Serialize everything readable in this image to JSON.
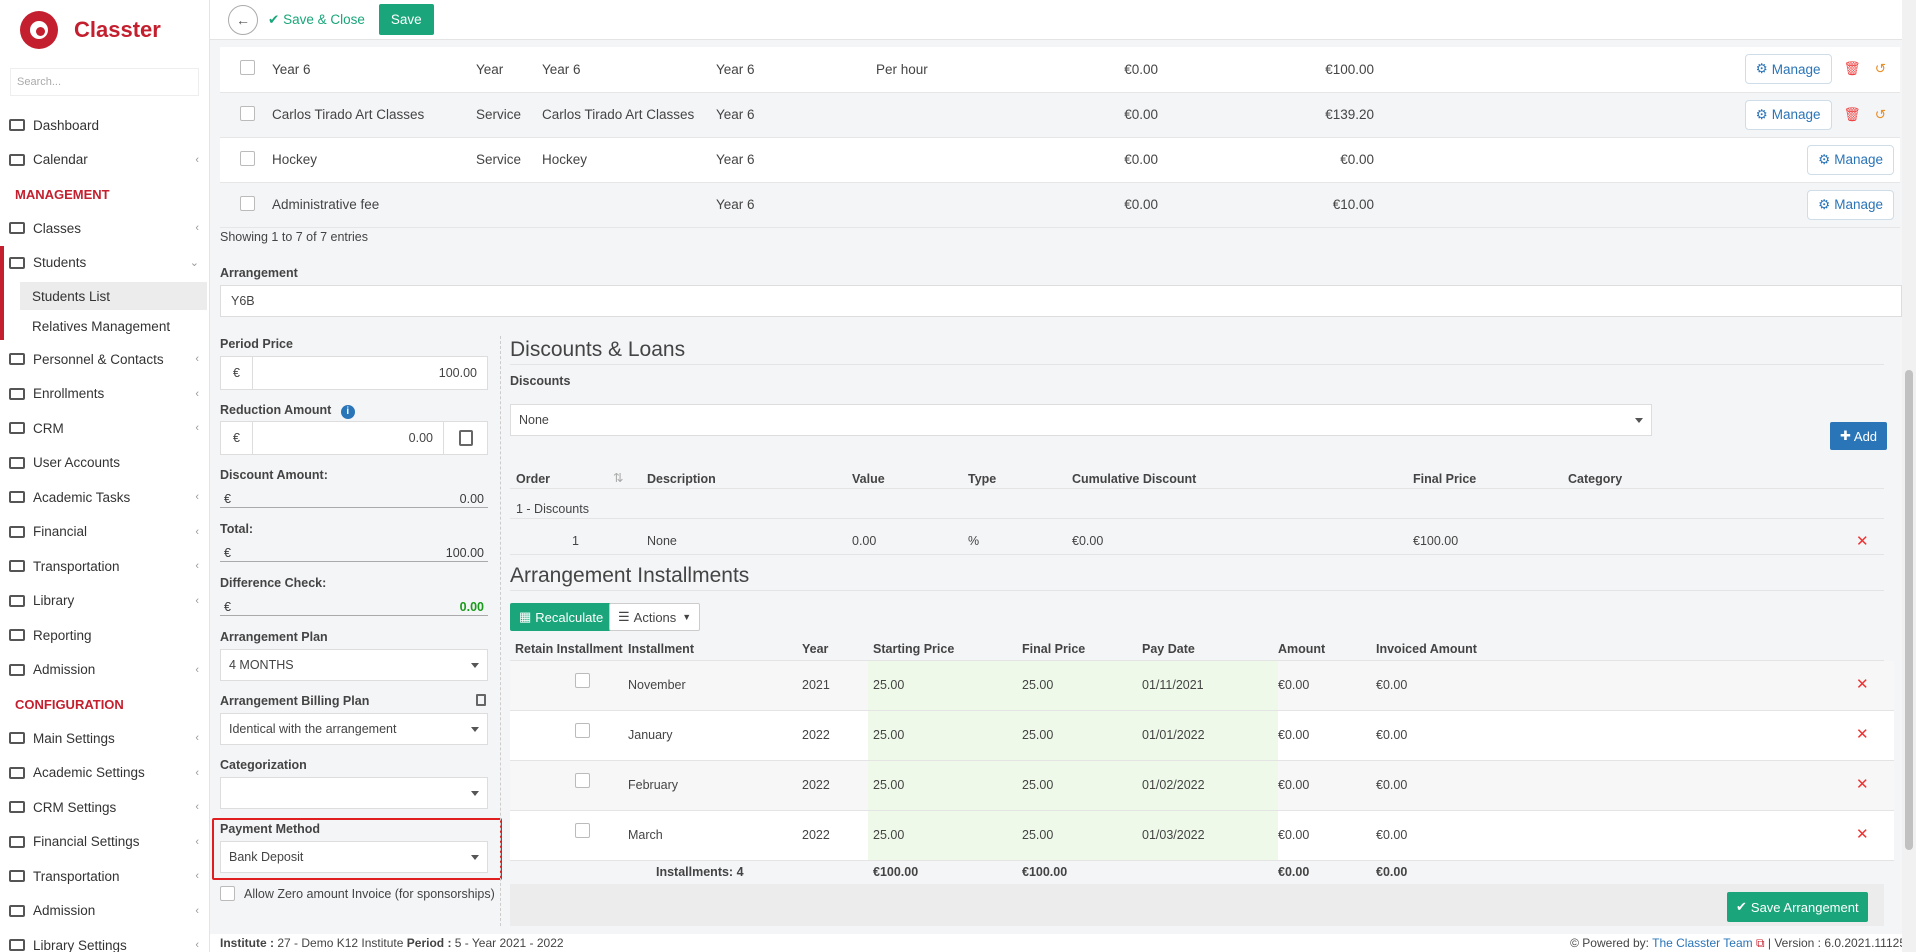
{
  "brand": {
    "name": "Classter"
  },
  "sidebar": {
    "search_placeholder": "Search...",
    "items_top": [
      {
        "label": "Dashboard",
        "chev": false
      },
      {
        "label": "Calendar",
        "chev": true
      }
    ],
    "management_header": "MANAGEMENT",
    "items_mgmt_a": [
      {
        "label": "Classes",
        "chev": true
      }
    ],
    "students": {
      "label": "Students",
      "subs": [
        "Students List",
        "Relatives Management"
      ]
    },
    "items_mgmt_b": [
      {
        "label": "Personnel & Contacts",
        "chev": true
      },
      {
        "label": "Enrollments",
        "chev": true
      },
      {
        "label": "CRM",
        "chev": true
      },
      {
        "label": "User Accounts",
        "chev": false
      },
      {
        "label": "Academic Tasks",
        "chev": true
      },
      {
        "label": "Financial",
        "chev": true
      },
      {
        "label": "Transportation",
        "chev": true
      },
      {
        "label": "Library",
        "chev": true
      },
      {
        "label": "Reporting",
        "chev": false
      },
      {
        "label": "Admission",
        "chev": true
      }
    ],
    "config_header": "CONFIGURATION",
    "items_config": [
      {
        "label": "Main Settings",
        "chev": true
      },
      {
        "label": "Academic Settings",
        "chev": true
      },
      {
        "label": "CRM Settings",
        "chev": true
      },
      {
        "label": "Financial Settings",
        "chev": true
      },
      {
        "label": "Transportation",
        "chev": true
      },
      {
        "label": "Admission",
        "chev": true
      },
      {
        "label": "Library Settings",
        "chev": true
      }
    ]
  },
  "toolbar": {
    "save_close": "Save & Close",
    "save": "Save"
  },
  "services": [
    {
      "name": "Year 6",
      "type": "Year",
      "desc": "Year 6",
      "year": "Year 6",
      "per": "Per hour",
      "v1": "€0.00",
      "v2": "€100.00",
      "manage": "Manage",
      "actions": true
    },
    {
      "name": "Carlos Tirado Art Classes",
      "type": "Service",
      "desc": "Carlos Tirado Art Classes",
      "year": "Year 6",
      "per": "",
      "v1": "€0.00",
      "v2": "€139.20",
      "manage": "Manage",
      "actions": true
    },
    {
      "name": "Hockey",
      "type": "Service",
      "desc": "Hockey",
      "year": "Year 6",
      "per": "",
      "v1": "€0.00",
      "v2": "€0.00",
      "manage": "Manage",
      "actions": false
    },
    {
      "name": "Administrative fee",
      "type": "",
      "desc": "",
      "year": "Year 6",
      "per": "",
      "v1": "€0.00",
      "v2": "€10.00",
      "manage": "Manage",
      "actions": false
    }
  ],
  "showing": "Showing 1 to 7 of 7 entries",
  "arrangement": {
    "label": "Arrangement",
    "value": "Y6B"
  },
  "left_form": {
    "period_price": {
      "label": "Period Price",
      "currency": "€",
      "value": "100.00"
    },
    "reduction": {
      "label": "Reduction Amount",
      "currency": "€",
      "value": "0.00"
    },
    "discount_amount": {
      "label": "Discount Amount:",
      "currency": "€",
      "value": "0.00"
    },
    "total": {
      "label": "Total:",
      "currency": "€",
      "value": "100.00"
    },
    "difference": {
      "label": "Difference Check:",
      "currency": "€",
      "value": "0.00"
    },
    "plan": {
      "label": "Arrangement Plan",
      "value": "4 MONTHS"
    },
    "billing": {
      "label": "Arrangement Billing Plan",
      "value": "Identical with the arrangement"
    },
    "categorization": {
      "label": "Categorization",
      "value": ""
    },
    "payment": {
      "label": "Payment Method",
      "value": "Bank Deposit"
    },
    "zero_invoice": "Allow Zero amount Invoice (for sponsorships)"
  },
  "discounts": {
    "title": "Discounts & Loans",
    "sub": "Discounts",
    "select": "None",
    "add": "Add",
    "headers": [
      "Order",
      "Description",
      "Value",
      "Type",
      "Cumulative Discount",
      "Final Price",
      "Category"
    ],
    "group": "1 - Discounts",
    "row": {
      "order": "1",
      "desc": "None",
      "value": "0.00",
      "type": "%",
      "cum": "€0.00",
      "final": "€100.00"
    }
  },
  "installments": {
    "title": "Arrangement Installments",
    "recalc": "Recalculate",
    "actions": "Actions",
    "headers": [
      "Retain Installment",
      "Installment",
      "Year",
      "Starting Price",
      "Final Price",
      "Pay Date",
      "Amount",
      "Invoiced Amount"
    ],
    "rows": [
      {
        "name": "November",
        "year": "2021",
        "start": "25.00",
        "final": "25.00",
        "date": "01/11/2021",
        "amount": "€0.00",
        "invoiced": "€0.00"
      },
      {
        "name": "January",
        "year": "2022",
        "start": "25.00",
        "final": "25.00",
        "date": "01/01/2022",
        "amount": "€0.00",
        "invoiced": "€0.00"
      },
      {
        "name": "February",
        "year": "2022",
        "start": "25.00",
        "final": "25.00",
        "date": "01/02/2022",
        "amount": "€0.00",
        "invoiced": "€0.00"
      },
      {
        "name": "March",
        "year": "2022",
        "start": "25.00",
        "final": "25.00",
        "date": "01/03/2022",
        "amount": "€0.00",
        "invoiced": "€0.00"
      }
    ],
    "totals": {
      "label": "Installments: 4",
      "start": "€100.00",
      "final": "€100.00",
      "amount": "€0.00",
      "invoiced": "€0.00"
    },
    "save": "Save Arrangement"
  },
  "footer": {
    "institute_label": "Institute :",
    "institute": "27 - Demo K12 Institute",
    "period_label": "Period :",
    "period": "5 - Year 2021 - 2022",
    "powered": "Powered by:",
    "team": "The Classter Team",
    "version": "| Version : 6.0.2021.11125"
  },
  "colors": {
    "brand": "#c41f2e",
    "green": "#1aa67a",
    "blue": "#2a74b8",
    "highlight": "#e02020"
  }
}
